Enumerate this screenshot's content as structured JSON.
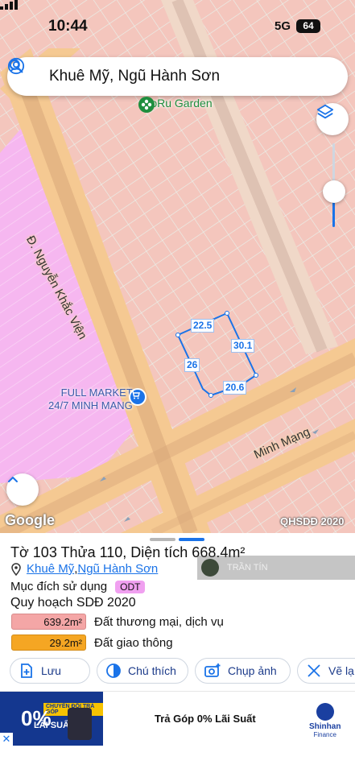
{
  "status": {
    "time": "10:44",
    "network": "5G",
    "battery": "64"
  },
  "search": {
    "query": "Khuê Mỹ, Ngũ Hành Sơn"
  },
  "map": {
    "poi_soru": "SoRu Garden",
    "road_nkv": "Đ. Nguyễn Khắc Viện",
    "road_mm": "Minh Mạng",
    "market_line1": "FULL MARKET",
    "market_line2": "24/7 MINH MANG",
    "dims": {
      "top": "22.5",
      "right": "30.1",
      "left": "26",
      "bottom": "20.6"
    },
    "logo": "Google",
    "credit": "QHSDĐ 2020"
  },
  "sheet": {
    "title": "Tờ 103 Thửa 110, Diện tích 668.4m²",
    "ward": "Khuê Mỹ",
    "separator": ", ",
    "district": "Ngũ Hành Sơn",
    "purpose_label": "Mục đích sử dụng",
    "purpose_code": "ODT",
    "plan_title": "Quy hoạch SDĐ 2020",
    "land_uses": [
      {
        "area": "639.2m²",
        "desc": "Đất thương mại, dịch vụ",
        "color": "#f4a6a6"
      },
      {
        "area": "29.2m²",
        "desc": "Đất giao thông",
        "color": "#f5a623"
      }
    ],
    "actions": {
      "save": "Lưu",
      "legend": "Chú thích",
      "photo": "Chụp ảnh",
      "draw": "Vẽ lạ"
    },
    "overlay_user": "TRẦN TÍN"
  },
  "ad": {
    "img_tag": "CHUYỂN ĐỔI TRẢ GÓP",
    "img_pct": "0%",
    "img_text": "LÃI SUẤT",
    "headline": "Trả Góp 0% Lãi Suất",
    "brand1": "Shinhan",
    "brand2": "Finance"
  },
  "colors": {
    "accent": "#1a73e8",
    "parcel_pink": "#f4c6bd",
    "road": "#f5c992",
    "commercial": "#f6b7f0"
  }
}
